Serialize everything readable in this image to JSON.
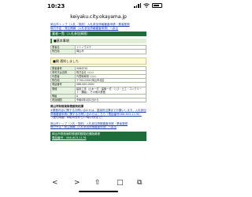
{
  "status_bar": {
    "time": "10:23",
    "signal_icon": "signal-bars-icon",
    "wifi_icon": "wifi-icon",
    "battery_icon": "battery-icon"
  },
  "browser": {
    "url": "keiyaku.city.okayama.jp",
    "back_icon": "back-arrow-icon",
    "back_symbol": "<",
    "forward_icon": "forward-arrow-icon",
    "forward_symbol": ">",
    "share_icon": "share-icon",
    "share_symbol": "⇧",
    "bookmarks_icon": "bookmarks-icon",
    "bookmarks_symbol": "□",
    "tabs_icon": "tabs-icon",
    "tabs_symbol": "⧉"
  },
  "breadcrumbs": {
    "line1": "岡山市トップ（入札・契約）入札参加資格審査申請・業者登録",
    "line2": "執行予定・発注情報（入札参加資格審査申請）へ戻る"
  },
  "page_title": "業者一覧（入札参加資格）",
  "basic_info": {
    "header": "■基本事項",
    "rows": [
      {
        "label": "業者名",
        "value": "トトノウエテ"
      },
      {
        "label": "所在地",
        "value": "岡山市"
      }
    ]
  },
  "notice": "■開 通知しました",
  "detail": {
    "rows": [
      {
        "label": "業者番号",
        "value": "0084310"
      },
      {
        "label": "商号又は名称",
        "value": "株式会社 ○○○"
      },
      {
        "label": "代表者",
        "value": "代表取締役 ○○○"
      },
      {
        "label": "所在地",
        "value": "〒700-0000 岡山市北区"
      },
      {
        "label": "電話番号",
        "value": "086-000-0000"
      },
      {
        "label": "業種",
        "value": "建設工事（土木一式・建築一式・とび・土工・コンクリート・舗装）・その他の業種"
      },
      {
        "label": "等級",
        "value": "A"
      },
      {
        "label": "有効期間",
        "value": "令和6年4月1日から"
      }
    ]
  },
  "contact": {
    "title": "岡山市財政局財務部契約課",
    "body": "※業務内容に関するお問い合わせは、直接担当課までお願いします。入札参加資格審査申請に関するお問い合わせはこちら（電話番号086-803-1176）",
    "extra": "（受付時間：8時30分から17時15分まで）"
  },
  "footer_links": {
    "line1": "岡山市トップ（入札・契約）入札参加資格審査申請・業者登録",
    "line2": "執行予定・発注情報（入札参加資格審査申請）へ戻る"
  },
  "org": {
    "name": "岡山市財政局財務部財務契約課指導係",
    "phone_label": "電話番号：086-803-1176"
  }
}
